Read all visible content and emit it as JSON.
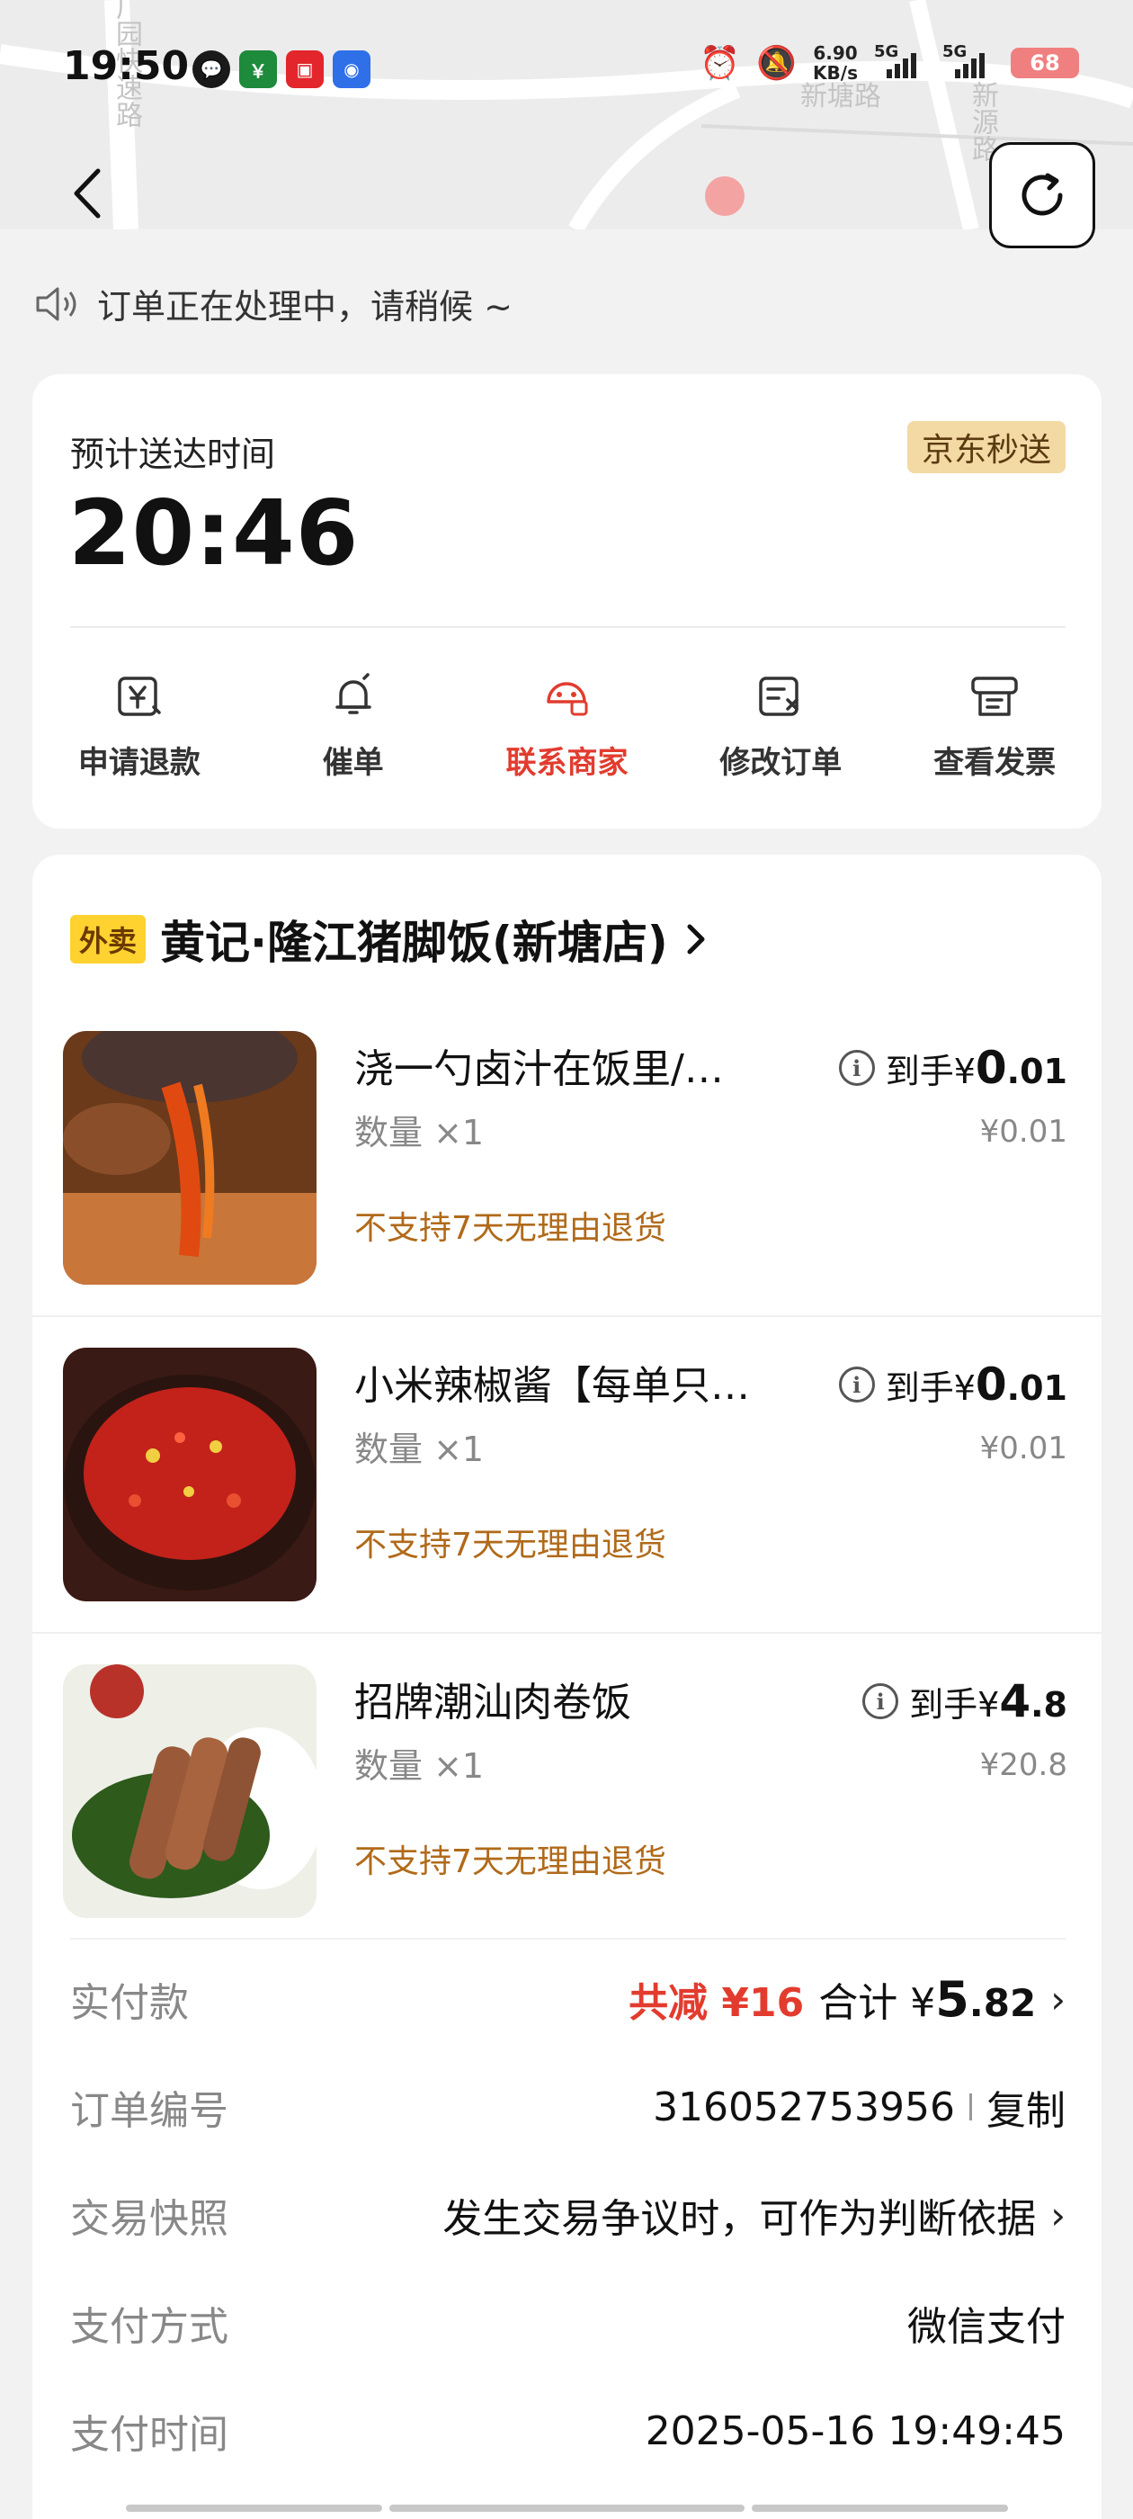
{
  "status_bar": {
    "time": "19:50",
    "net_speed_value": "6.90",
    "net_speed_unit": "KB/s",
    "signal1_label": "5G",
    "signal2_label": "5G",
    "battery": "68"
  },
  "map": {
    "road_label_1": "广园快速路",
    "road_label_2": "新塘路",
    "road_label_3": "新源路"
  },
  "notice": {
    "text": "订单正在处理中，请稍候 ~"
  },
  "delivery": {
    "eta_label": "预计送达时间",
    "eta_time": "20:46",
    "service_badge": "京东秒送",
    "actions": [
      {
        "label": "申请退款",
        "icon": "refund-icon"
      },
      {
        "label": "催单",
        "icon": "bell-icon"
      },
      {
        "label": "联系商家",
        "icon": "merchant-chat-icon",
        "active": true
      },
      {
        "label": "修改订单",
        "icon": "edit-order-icon"
      },
      {
        "label": "查看发票",
        "icon": "invoice-icon"
      }
    ]
  },
  "store": {
    "tag": "外卖",
    "name": "黄记·隆江猪脚饭(新塘店)"
  },
  "items": [
    {
      "name": "浇一勺卤汁在饭里/…",
      "qty": "数量 ×1",
      "policy": "不支持7天无理由退货",
      "final_prefix": "到手¥",
      "final_big": "0",
      "final_small": ".01",
      "original": "¥0.01"
    },
    {
      "name": "小米辣椒酱【每单只…",
      "qty": "数量 ×1",
      "policy": "不支持7天无理由退货",
      "final_prefix": "到手¥",
      "final_big": "0",
      "final_small": ".01",
      "original": "¥0.01"
    },
    {
      "name": "招牌潮汕肉卷饭",
      "qty": "数量 ×1",
      "policy": "不支持7天无理由退货",
      "final_prefix": "到手¥",
      "final_big": "4",
      "final_small": ".8",
      "original": "¥20.8"
    }
  ],
  "payment": {
    "paid_label": "实付款",
    "discount": "共减 ¥16",
    "total_prefix": "合计 ¥",
    "total_big": "5",
    "total_small": ".82",
    "order_no_label": "订单编号",
    "order_no": "316052753956",
    "copy_label": "复制",
    "snapshot_label": "交易快照",
    "snapshot_text": "发生交易争议时，可作为判断依据",
    "method_label": "支付方式",
    "method": "微信支付",
    "time_label": "支付时间",
    "time": "2025-05-16 19:49:45"
  },
  "colors": {
    "accent_red": "#e23c2f",
    "policy_orange": "#b06a1a",
    "badge_gold": "#f3d9a3",
    "store_tag_yellow": "#ffd230"
  }
}
